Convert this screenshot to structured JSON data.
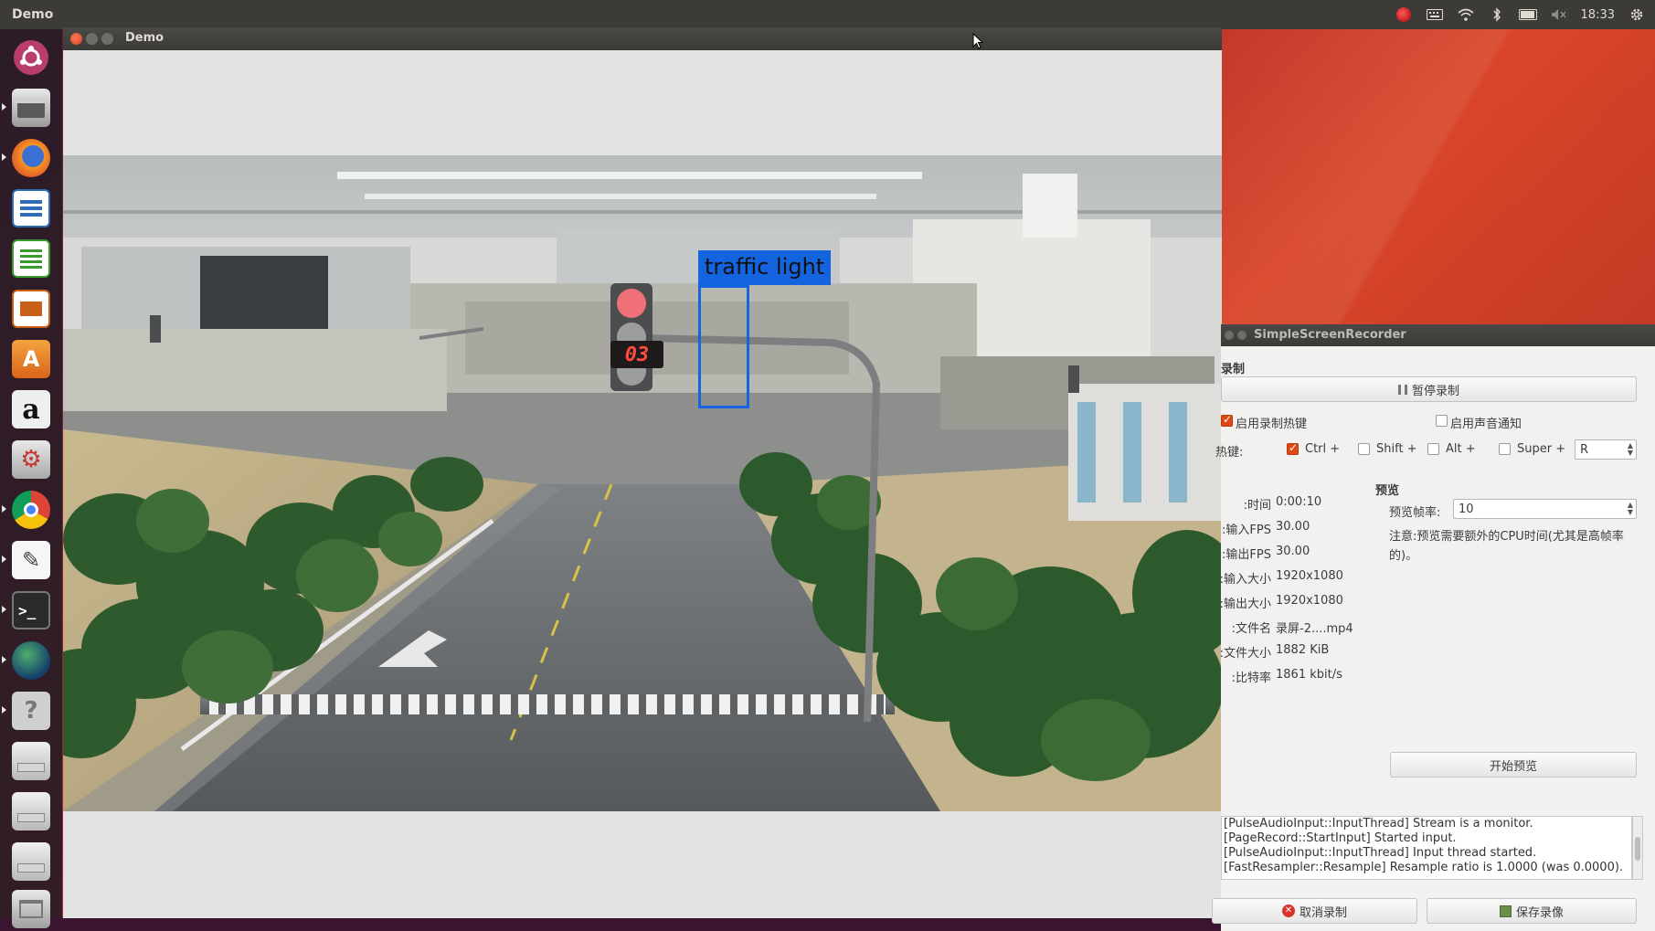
{
  "topbar": {
    "app_title": "Demo",
    "clock": "18:33",
    "tray_icons": [
      "recorder-icon",
      "keyboard-icon",
      "wifi-icon",
      "bluetooth-icon",
      "battery-icon",
      "volume-muted-icon",
      "settings-gear-icon"
    ]
  },
  "launcher": {
    "items": [
      "ubuntu-dash-icon",
      "files-icon",
      "firefox-icon",
      "writer-icon",
      "calc-icon",
      "impress-icon",
      "software-center-icon",
      "amazon-icon",
      "system-settings-icon",
      "chrome-icon",
      "text-editor-icon",
      "terminal-icon",
      "globe-app-icon",
      "help-icon",
      "drive-icon",
      "drive-icon",
      "drive-icon",
      "trash-icon"
    ]
  },
  "demo_window": {
    "title": "Demo",
    "detection_label": "traffic light",
    "countdown_display": "03"
  },
  "recorder": {
    "title": "SimpleScreenRecorder",
    "section_recording": "录制",
    "pause_button": "暂停录制",
    "enable_hotkey": "启用录制热键",
    "enable_sound_notify": "启用声音通知",
    "hotkey_label": "热键:",
    "mod_ctrl": "Ctrl +",
    "mod_shift": "Shift +",
    "mod_alt": "Alt +",
    "mod_super": "Super +",
    "hotkey_key": "R",
    "stats": [
      {
        "label": "时间:",
        "value": "0:00:10"
      },
      {
        "label": "输入FPS:",
        "value": "30.00"
      },
      {
        "label": "输出FPS:",
        "value": "30.00"
      },
      {
        "label": "输入大小:",
        "value": "1920x1080"
      },
      {
        "label": "输出大小:",
        "value": "1920x1080"
      },
      {
        "label": "文件名:",
        "value": "录屏-2....mp4"
      },
      {
        "label": "文件大小:",
        "value": "1882 KiB"
      },
      {
        "label": "比特率:",
        "value": "1861 kbit/s"
      }
    ],
    "preview_heading": "预览",
    "preview_rate_label": "预览帧率:",
    "preview_rate_value": "10",
    "preview_note": "注意:预览需要额外的CPU时间(尤其是高帧率的)。",
    "start_preview": "开始预览",
    "log_lines": [
      "[PulseAudioInput::InputThread] Stream is a monitor.",
      "[PageRecord::StartInput] Started input.",
      "[PulseAudioInput::InputThread] Input thread started.",
      "[FastResampler::Resample] Resample ratio is 1.0000 (was 0.0000)."
    ],
    "cancel_button": "取消录制",
    "save_button": "保存录像"
  }
}
